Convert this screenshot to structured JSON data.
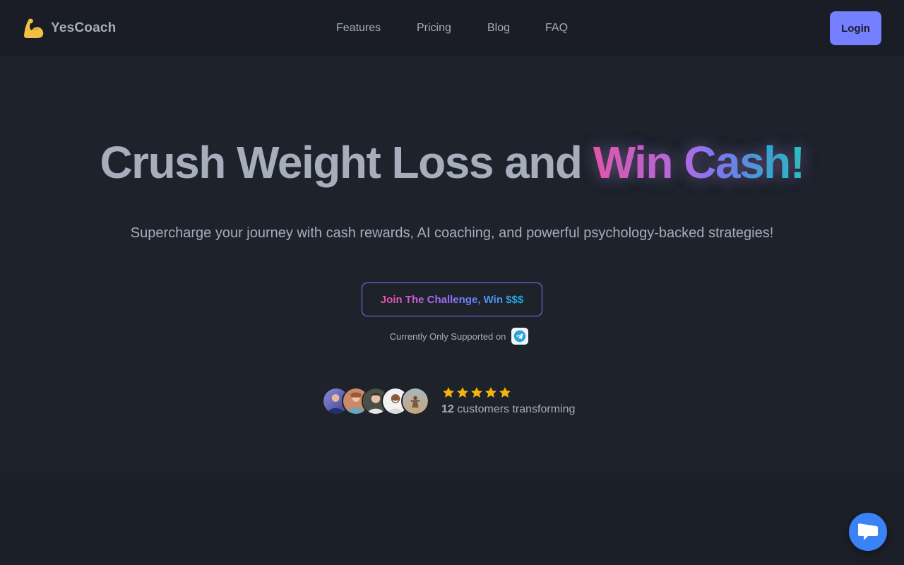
{
  "brand": {
    "name": "YesCoach",
    "icon": "flexed-biceps-icon"
  },
  "nav": [
    {
      "label": "Features"
    },
    {
      "label": "Pricing"
    },
    {
      "label": "Blog"
    },
    {
      "label": "FAQ"
    }
  ],
  "header": {
    "login_label": "Login"
  },
  "hero": {
    "headline_plain": "Crush Weight Loss and ",
    "headline_highlight": "Win Cash!",
    "subtitle": "Supercharge your journey with cash rewards, AI coaching, and powerful psychology-backed strategies!",
    "cta_label": "Join The Challenge, Win $$$",
    "support_text": "Currently Only Supported on",
    "support_icon": "telegram-icon"
  },
  "social_proof": {
    "rating_stars": 5,
    "customer_count": "12",
    "customer_text": " customers transforming"
  },
  "chat": {
    "icon": "chat-bubble-icon"
  },
  "colors": {
    "background": "#1b1f27",
    "accent": "#7480ff",
    "gradient_pink": "#f34fa6",
    "gradient_cyan": "#1fcfbf",
    "star": "#f5b40b",
    "chat_button": "#3b82f6"
  }
}
